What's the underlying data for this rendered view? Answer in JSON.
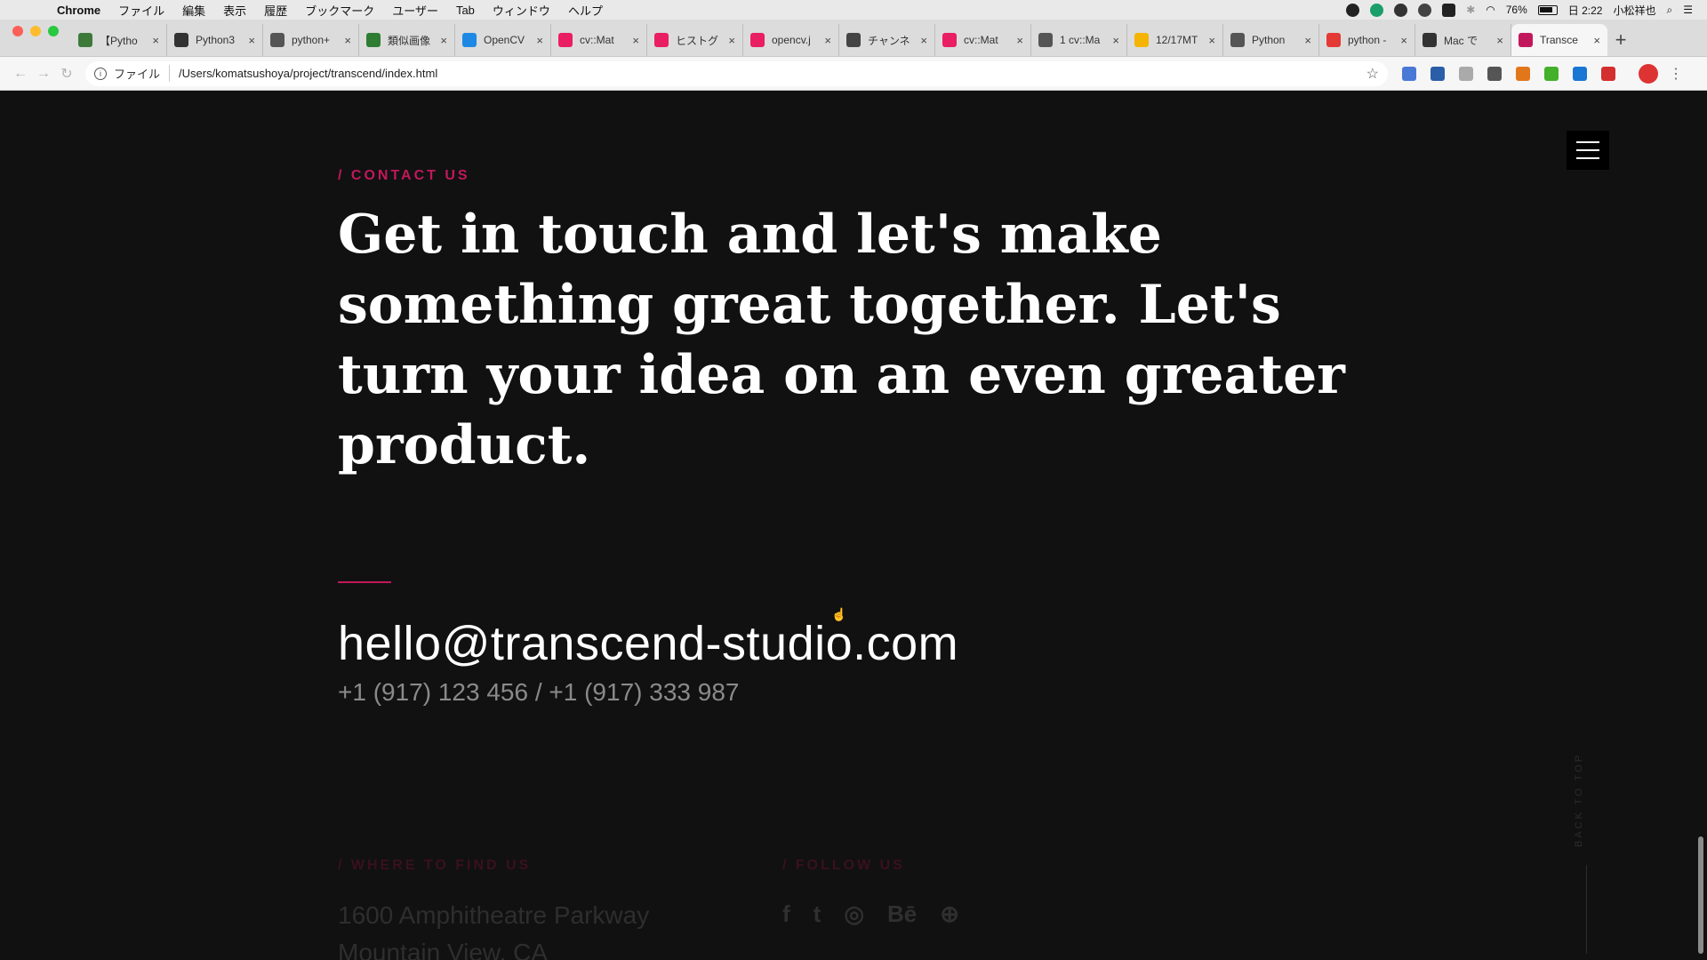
{
  "menubar": {
    "app": "Chrome",
    "items": [
      "ファイル",
      "編集",
      "表示",
      "履歴",
      "ブックマーク",
      "ユーザー",
      "Tab",
      "ウィンドウ",
      "ヘルプ"
    ],
    "battery": "76%",
    "clock": "日 2:22",
    "user": "小松祥也"
  },
  "tabs": [
    {
      "label": "【Pytho",
      "color": "#3d7a3a"
    },
    {
      "label": "Python3",
      "color": "#333333"
    },
    {
      "label": "python+",
      "color": "#555555"
    },
    {
      "label": "類似画像",
      "color": "#2e7d32"
    },
    {
      "label": "OpenCV",
      "color": "#1e88e5"
    },
    {
      "label": "cv::Mat",
      "color": "#e91e63"
    },
    {
      "label": "ヒストグ",
      "color": "#e91e63"
    },
    {
      "label": "opencv.j",
      "color": "#e91e63"
    },
    {
      "label": "チャンネ",
      "color": "#444444"
    },
    {
      "label": "cv::Mat",
      "color": "#e91e63"
    },
    {
      "label": "1 cv::Ma",
      "color": "#555555"
    },
    {
      "label": "12/17MT",
      "color": "#f5b400"
    },
    {
      "label": "Python",
      "color": "#555555"
    },
    {
      "label": "python -",
      "color": "#e53935"
    },
    {
      "label": "Mac で",
      "color": "#333333"
    },
    {
      "label": "Transce",
      "color": "#c2185b"
    }
  ],
  "address": {
    "scheme": "ファイル",
    "url": "/Users/komatsushoya/project/transcend/index.html"
  },
  "contact": {
    "label": "/ CONTACT US",
    "headline": "Get in touch and let's make something great together. Let's turn your idea on an even greater product.",
    "email": "hello@transcend-studio.com",
    "phones": "+1 (917) 123 456 / +1 (917) 333 987"
  },
  "footer": {
    "where_label": "/ WHERE TO FIND US",
    "address_line1": "1600 Amphitheatre Parkway",
    "address_line2": "Mountain View, CA",
    "follow_label": "/ FOLLOW US",
    "social": [
      "f",
      "t",
      "◎",
      "Bē",
      "⊕"
    ],
    "back_to_top": "BACK TO TOP"
  }
}
